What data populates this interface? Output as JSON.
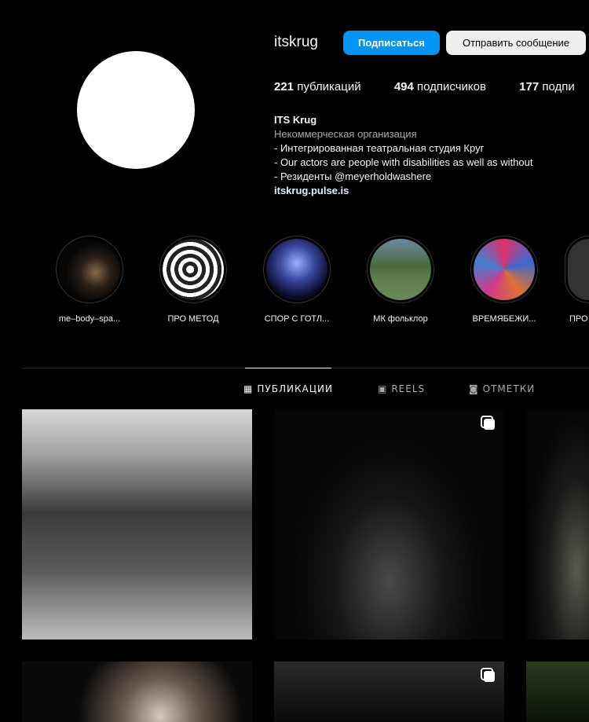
{
  "profile": {
    "username": "itskrug",
    "follow_label": "Подписаться",
    "message_label": "Отправить сообщение"
  },
  "stats": [
    {
      "count": "221",
      "label": "публикаций"
    },
    {
      "count": "494",
      "label": "подписчиков"
    },
    {
      "count": "177",
      "label": "подпи"
    }
  ],
  "bio": {
    "name": "ITS Krug",
    "category": "Некоммерческая организация",
    "lines": [
      "- Интегрированная театральная студия Круг",
      "- Our actors are people with disabilities as well as without",
      "- Резиденты @meyerholdwashere"
    ],
    "link": "itskrug.pulse.is"
  },
  "highlights": [
    {
      "label": "me–body–spa..."
    },
    {
      "label": "ПРО МЕТОД"
    },
    {
      "label": "СПОР С ГОТЛ..."
    },
    {
      "label": "МК фольклор"
    },
    {
      "label": "ВРЕМЯБЕЖИ..."
    },
    {
      "label": "ПРО"
    }
  ],
  "tabs": [
    {
      "label": "ПУБЛИКАЦИИ",
      "icon": "grid-icon"
    },
    {
      "label": "REELS",
      "icon": "reels-icon"
    },
    {
      "label": "ОТМЕТКИ",
      "icon": "tagged-icon"
    }
  ]
}
